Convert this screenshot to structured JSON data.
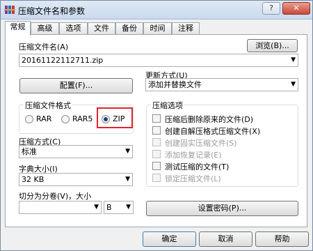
{
  "window": {
    "title": "压缩文件名和参数",
    "help_label": "?",
    "close_label": "✕"
  },
  "tabs": [
    {
      "label": "常规"
    },
    {
      "label": "高级"
    },
    {
      "label": "选项"
    },
    {
      "label": "文件"
    },
    {
      "label": "备份"
    },
    {
      "label": "时间"
    },
    {
      "label": "注释"
    }
  ],
  "archive_name": {
    "label": "压缩文件名(A)",
    "value": "20161122112711.zip",
    "browse_label": "浏览(B)..."
  },
  "update_mode": {
    "label": "更新方式(U)",
    "value": "添加并替换文件"
  },
  "profile_button": "配置(F)...",
  "format": {
    "title": "压缩文件格式",
    "options": [
      "RAR",
      "RAR5",
      "ZIP"
    ],
    "selected": "ZIP"
  },
  "compression_method": {
    "label": "压缩方式(C)",
    "value": "标准"
  },
  "dictionary_size": {
    "label": "字典大小(I)",
    "value": "32 KB"
  },
  "split": {
    "label": "切分为分卷(V)，大小",
    "value": "",
    "unit": "B"
  },
  "options": {
    "title": "压缩选项",
    "items": [
      {
        "label": "压缩后删除原来的文件(D)",
        "enabled": true
      },
      {
        "label": "创建自解压格式压缩文件(X)",
        "enabled": true
      },
      {
        "label": "创建固实压缩文件(S)",
        "enabled": false
      },
      {
        "label": "添加恢复记录(E)",
        "enabled": false
      },
      {
        "label": "测试压缩的文件(T)",
        "enabled": true
      },
      {
        "label": "锁定压缩文件(L)",
        "enabled": false
      }
    ]
  },
  "password_button": "设置密码(P)...",
  "footer": {
    "ok": "确定",
    "cancel": "取消",
    "help": "帮助"
  },
  "colors": {
    "highlight": "#e0242b",
    "titlebar": "#c9d9ee"
  }
}
